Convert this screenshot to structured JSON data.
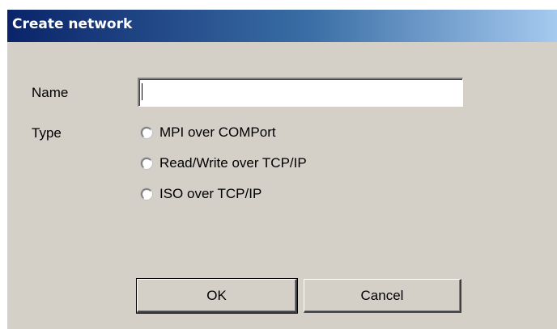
{
  "window": {
    "title": "Create network"
  },
  "form": {
    "name_label": "Name",
    "name_value": "",
    "type_label": "Type",
    "type_options": [
      {
        "label": "MPI over COMPort",
        "selected": false
      },
      {
        "label": "Read/Write over TCP/IP",
        "selected": false
      },
      {
        "label": "ISO over TCP/IP",
        "selected": false
      }
    ]
  },
  "buttons": {
    "ok_label": "OK",
    "cancel_label": "Cancel"
  },
  "colors": {
    "titlebar_start": "#0a246a",
    "titlebar_end": "#a6caf0",
    "dialog_bg": "#d4d0c8"
  }
}
